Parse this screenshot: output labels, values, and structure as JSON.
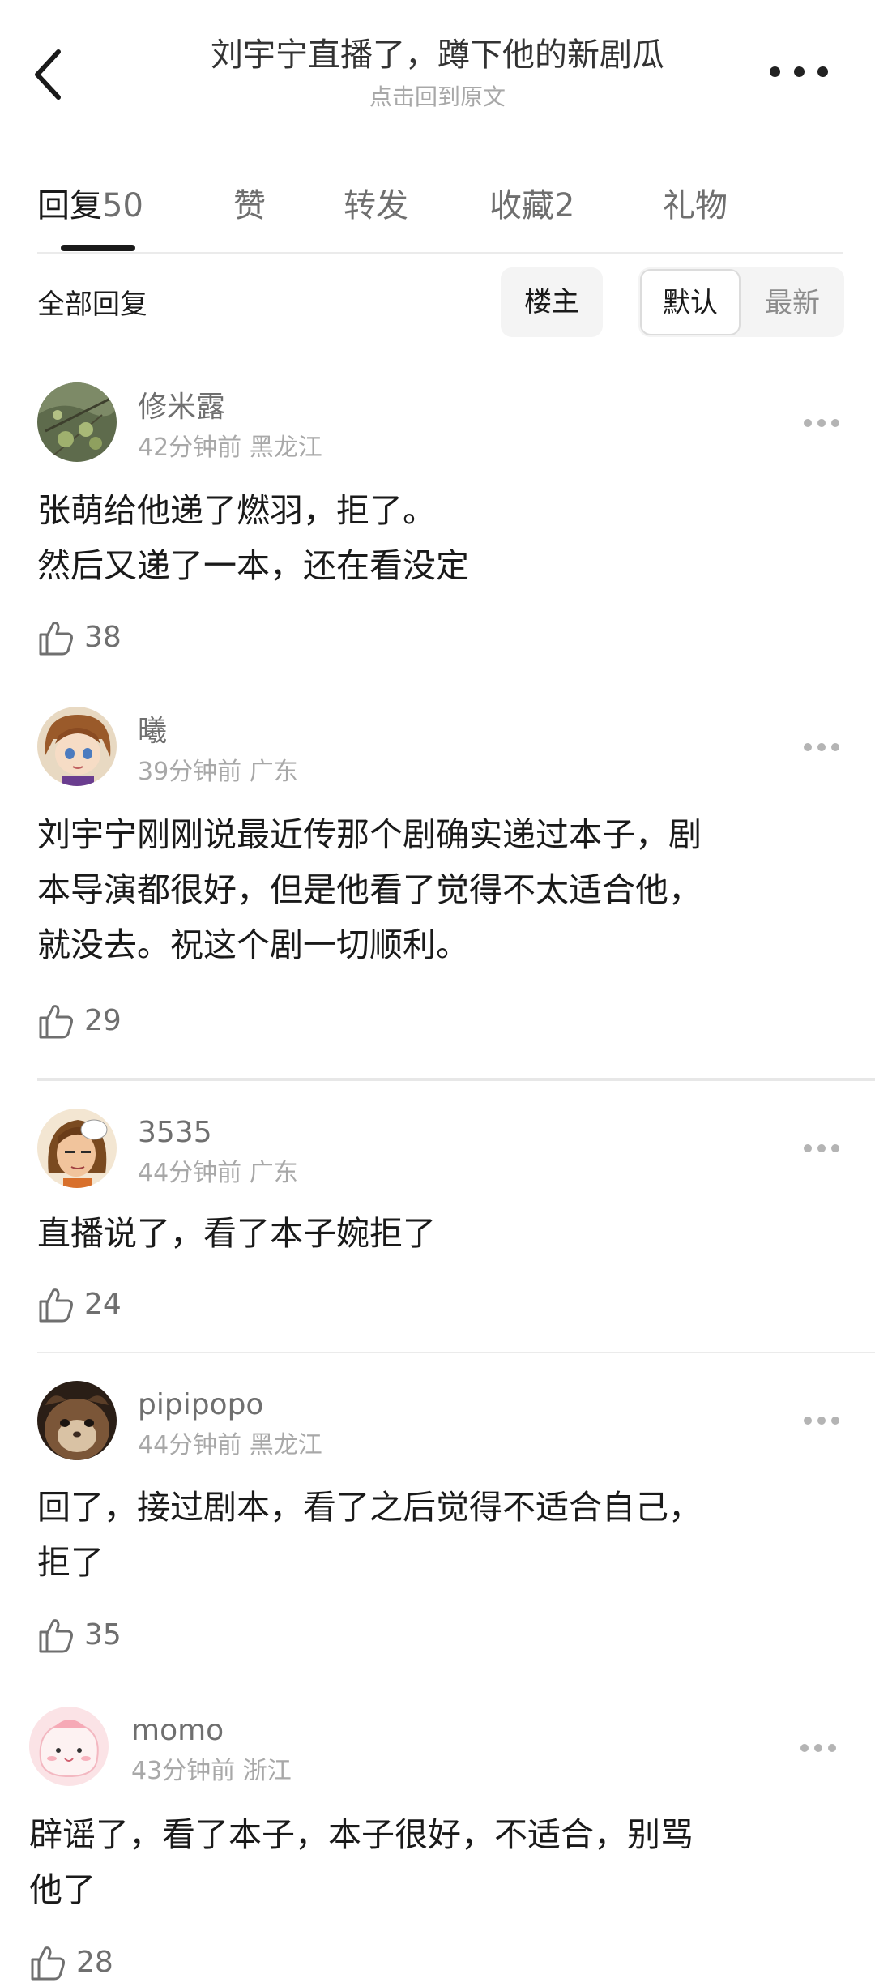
{
  "header": {
    "title": "刘宇宁直播了，蹲下他的新剧瓜",
    "subtitle": "点击回到原文"
  },
  "tabs": [
    {
      "label": "回复",
      "count": "50"
    },
    {
      "label": "赞",
      "count": ""
    },
    {
      "label": "转发",
      "count": ""
    },
    {
      "label": "收藏",
      "count": "2"
    },
    {
      "label": "礼物",
      "count": ""
    }
  ],
  "filter": {
    "label": "全部回复",
    "owner_chip": "楼主",
    "sort_default": "默认",
    "sort_latest": "最新"
  },
  "comments": [
    {
      "user": "修米露",
      "time": "42分钟前",
      "location": "黑龙江",
      "lines": [
        "张萌给他递了燃羽，拒了。",
        "然后又递了一本，还在看没定"
      ],
      "likes": "38"
    },
    {
      "user": "曦",
      "time": "39分钟前",
      "location": "广东",
      "lines": [
        "刘宇宁刚刚说最近传那个剧确实递过本子，剧",
        "本导演都很好，但是他看了觉得不太适合他，",
        "就没去。祝这个剧一切顺利。"
      ],
      "likes": "29"
    },
    {
      "user": "3535",
      "time": "44分钟前",
      "location": "广东",
      "lines": [
        "直播说了，看了本子婉拒了"
      ],
      "likes": "24"
    },
    {
      "user": "pipipopo",
      "time": "44分钟前",
      "location": "黑龙江",
      "lines": [
        "回了，接过剧本，看了之后觉得不适合自己，",
        "拒了"
      ],
      "likes": "35"
    },
    {
      "user": "momo",
      "time": "43分钟前",
      "location": "浙江",
      "lines": [
        "辟谣了，看了本子，本子很好，不适合，别骂",
        "他了"
      ],
      "likes": "28"
    }
  ],
  "icons": {
    "back": "back-arrow-icon",
    "more": "more-icon",
    "like": "thumbs-up-icon"
  }
}
